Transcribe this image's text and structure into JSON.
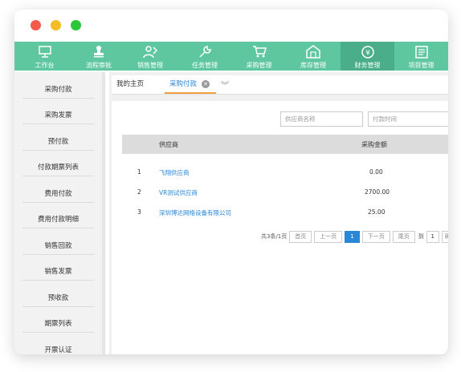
{
  "nav": {
    "items": [
      {
        "label": "工作台",
        "icon": "monitor-icon"
      },
      {
        "label": "流程审批",
        "icon": "stamp-icon"
      },
      {
        "label": "销售管理",
        "icon": "sales-person-icon"
      },
      {
        "label": "任务管理",
        "icon": "wrench-icon"
      },
      {
        "label": "采购管理",
        "icon": "cart-icon"
      },
      {
        "label": "库存管理",
        "icon": "warehouse-icon"
      },
      {
        "label": "财务管理",
        "icon": "money-bag-icon"
      },
      {
        "label": "项目管理",
        "icon": "clipboard-icon"
      }
    ],
    "active_label": "财务管理",
    "accent": "#5ec7a0"
  },
  "sidebar": {
    "items": [
      "采购付款",
      "采购发票",
      "预付款",
      "付款期票列表",
      "费用付款",
      "费用付款明细",
      "销售回款",
      "销售发票",
      "预收款",
      "期票列表",
      "开票认证"
    ]
  },
  "tabs": {
    "home": "我的主页",
    "active": "采购付款"
  },
  "filters": {
    "supplier_placeholder": "供应商名称",
    "time_placeholder": "付款时间"
  },
  "table": {
    "headers": [
      "供应商",
      "采购金额"
    ],
    "rows": [
      {
        "index": "1",
        "supplier": "飞翔供应商",
        "amount": "0.00"
      },
      {
        "index": "2",
        "supplier": "VR测试供应商",
        "amount": "2700.00"
      },
      {
        "index": "3",
        "supplier": "深圳博达网络设备有限公司",
        "amount": "25.00"
      }
    ]
  },
  "pager": {
    "summary": "共3条/1页",
    "first": "首页",
    "prev": "上一页",
    "current": "1",
    "next": "下一页",
    "last": "尾页",
    "goto": "到",
    "goto_value": "1",
    "confirm": "确"
  }
}
